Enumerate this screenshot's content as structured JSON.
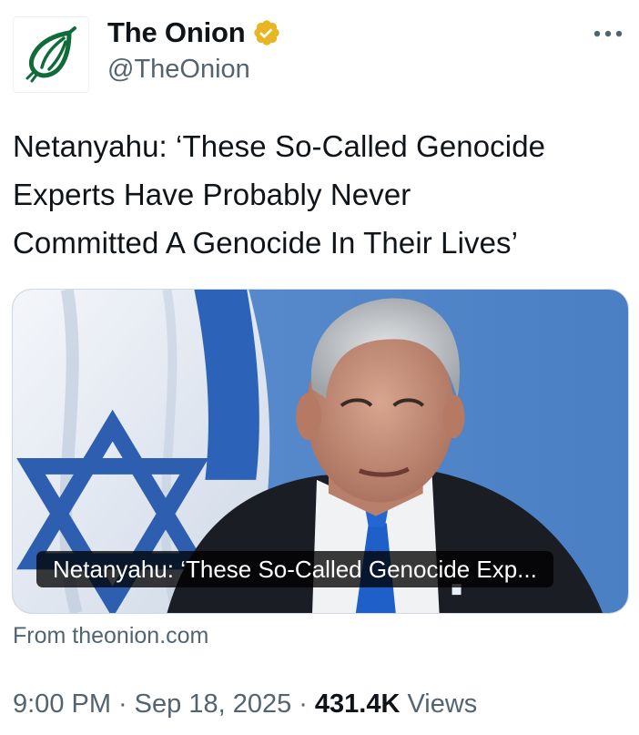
{
  "account": {
    "display_name": "The Onion",
    "handle": "@TheOnion",
    "verified_icon": "verified-badge-icon",
    "avatar_icon": "onion-logo-icon",
    "brand_color": "#0f6b3a",
    "badge_color": "#e8b623"
  },
  "menu": {
    "more_icon": "more-options-icon"
  },
  "tweet": {
    "text_lines": [
      "Netanyahu: ‘These So-Called Genocide",
      "Experts Have Probably Never",
      "Committed A Genocide In Their Lives’"
    ]
  },
  "card": {
    "title": "Netanyahu: ‘These So-Called Genocide Exp...",
    "source": "From theonion.com"
  },
  "meta": {
    "time": "9:00 PM",
    "separator": "·",
    "date": "Sep 18, 2025",
    "views_count": "431.4K",
    "views_label": "Views"
  }
}
